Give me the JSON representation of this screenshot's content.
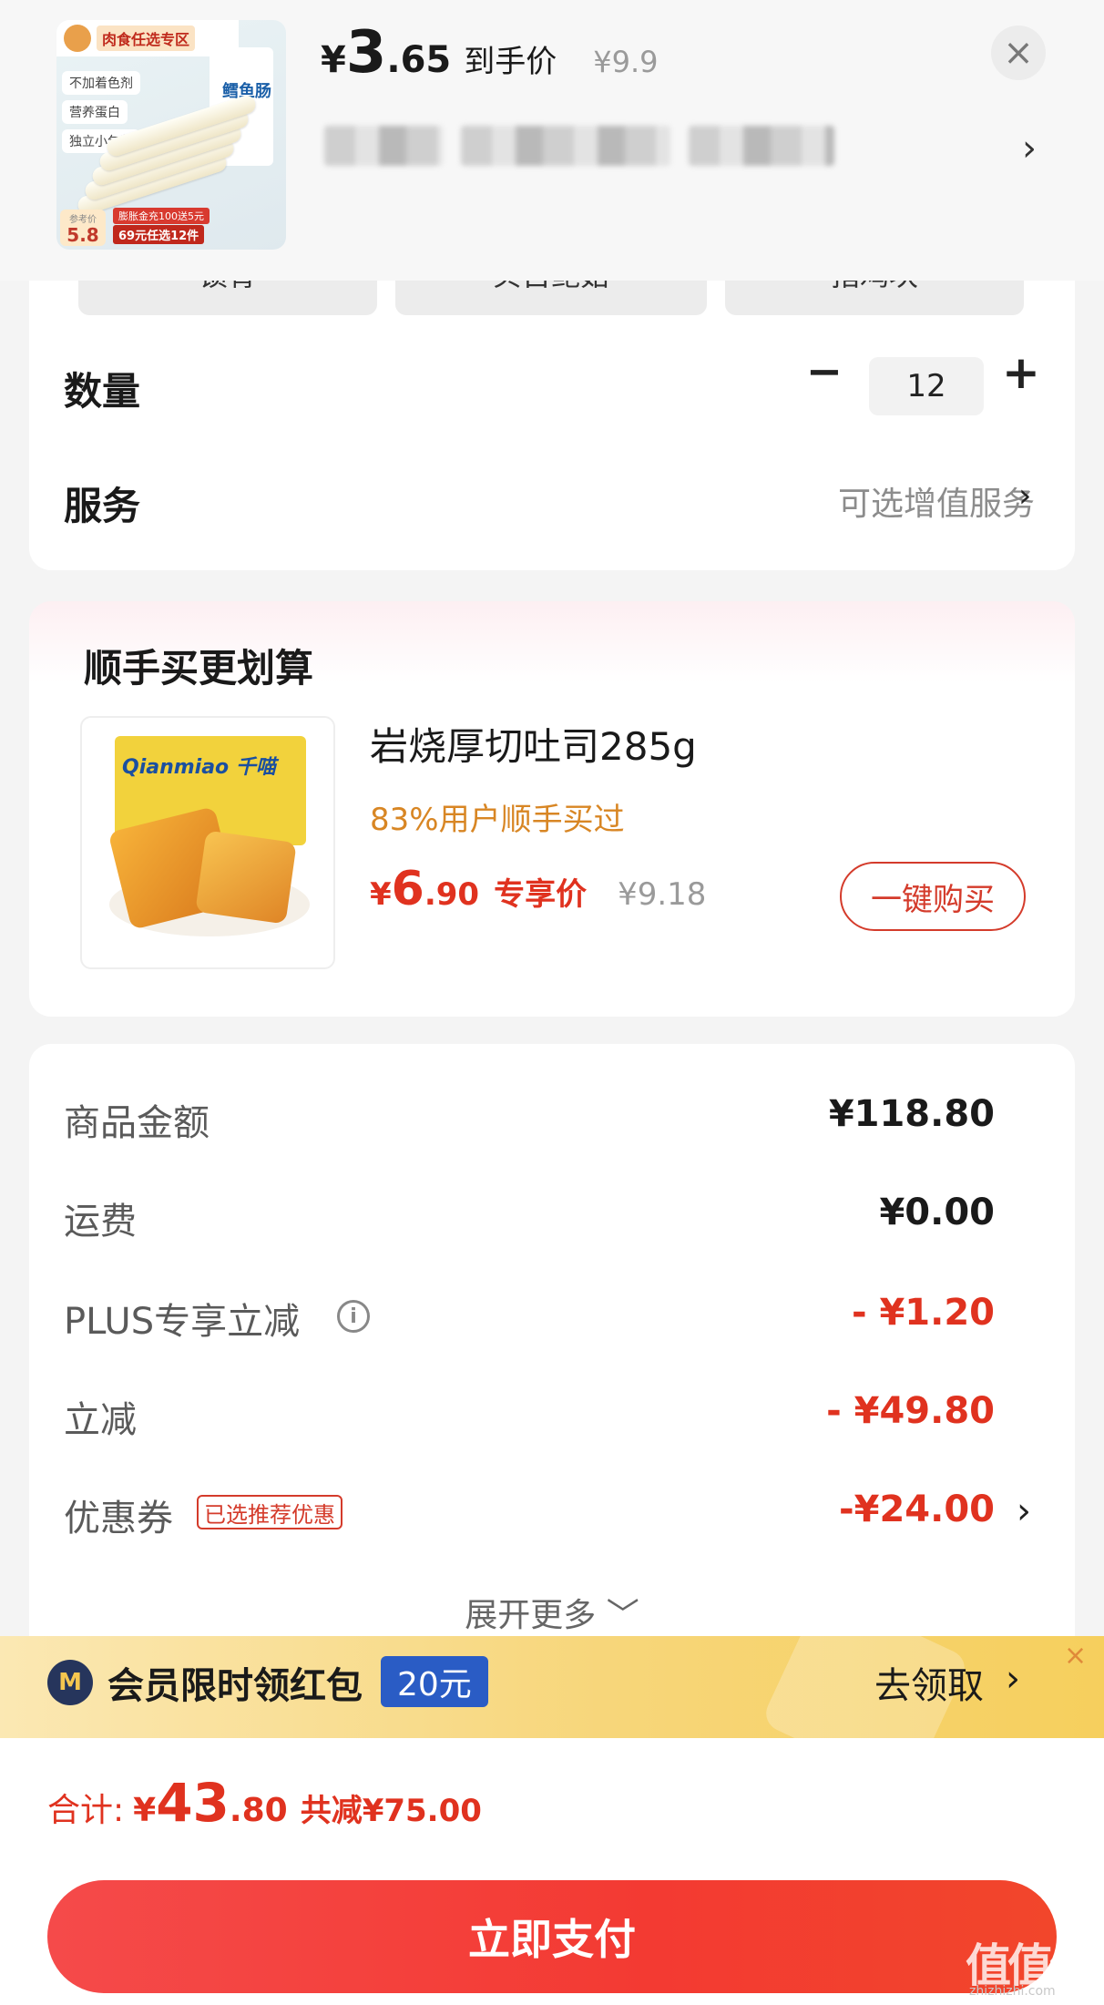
{
  "header": {
    "thumb": {
      "tag": "肉食任选专区",
      "features": [
        "不加着色剂",
        "营养蛋白",
        "独立小包装"
      ],
      "package_text": "鳕鱼肠",
      "ref_label": "参考价",
      "ref_price": "5.8",
      "promo_line1": "膨胀金充100送5元",
      "promo_line2": "69元任选12件"
    },
    "price_currency": "¥",
    "price_int": "3",
    "price_dec": ".65",
    "price_label": "到手价",
    "original_price": "¥9.9",
    "close_symbol": "×",
    "chevron": "›"
  },
  "spec_chips": [
    "锁骨",
    "贝古鲍菇",
    "指鸡块"
  ],
  "quantity": {
    "label": "数量",
    "value": "12",
    "minus": "−",
    "plus": "+"
  },
  "service": {
    "label": "服务",
    "value": "可选增值服务",
    "chevron": "›"
  },
  "addon": {
    "title": "顺手买更划算",
    "image_text": "Qianmiao 千喵",
    "name": "岩烧厚切吐司285g",
    "users": "83%用户顺手买过",
    "price_currency": "¥",
    "price_int": "6",
    "price_dec": ".90",
    "price_label": "专享价",
    "original_price": "¥9.18",
    "buy_label": "一键购买"
  },
  "fees": [
    {
      "label": "商品金额",
      "value": "¥118.80",
      "red": false
    },
    {
      "label": "运费",
      "value": "¥0.00",
      "red": false
    },
    {
      "label": "PLUS专享立减",
      "value": "- ¥1.20",
      "red": true
    },
    {
      "label": "立减",
      "value": "- ¥49.80",
      "red": true
    },
    {
      "label": "优惠券",
      "value": "-¥24.00",
      "red": true
    }
  ],
  "info_icon": "i",
  "coupon_badge": "已选推荐优惠",
  "coupon_chevron": "›",
  "expand_label": "展开更多 ﹀",
  "banner": {
    "vip_symbol": "M",
    "text": "会员限时领红包",
    "amount": "20元",
    "cta": "去领取",
    "chevron": "›",
    "close": "×"
  },
  "footer": {
    "total_label": "合计:",
    "total_currency": "¥",
    "total_int": "43",
    "total_dec": ".80",
    "savings": "共减¥75.00",
    "pay_label": "立即支付"
  },
  "watermark": {
    "text": "值值值",
    "sub": "zhizhizhi.com"
  },
  "colors": {
    "accent_red": "#e0321f",
    "orange": "#d88624",
    "banner_yellow": "#f7d67a",
    "badge_blue": "#2a5cc5"
  }
}
